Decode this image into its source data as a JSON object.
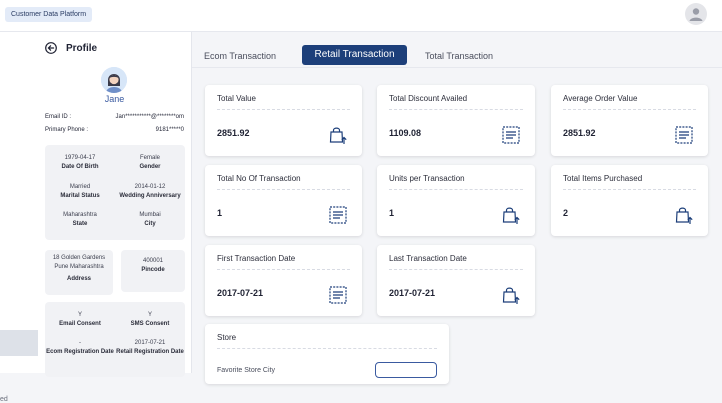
{
  "app": {
    "title": "Customer Data Platform"
  },
  "profile": {
    "title": "Profile",
    "name": "Jane",
    "email_label": "Email ID :",
    "email_value": "Jan***********@********om",
    "phone_label": "Primary Phone :",
    "phone_value": "9181*****0",
    "details": [
      {
        "value": "1979-04-17",
        "label": "Date Of Birth"
      },
      {
        "value": "Female",
        "label": "Gender"
      },
      {
        "value": "Married",
        "label": "Marital Status"
      },
      {
        "value": "2014-01-12",
        "label": "Wedding Anniversary"
      },
      {
        "value": "Maharashtra",
        "label": "State"
      },
      {
        "value": "Mumbai",
        "label": "City"
      }
    ],
    "address": {
      "line1": "18 Golden Gardens",
      "line2": "Pune Maharashtra",
      "label": "Address"
    },
    "pincode": {
      "value": "400001",
      "label": "Pincode"
    },
    "consents": [
      {
        "value": "Y",
        "label": "Email Consent"
      },
      {
        "value": "Y",
        "label": "SMS Consent"
      },
      {
        "value": "-",
        "label": "Ecom Registration Date"
      },
      {
        "value": "2017-07-21",
        "label": "Retail Registration Date"
      }
    ]
  },
  "tabs": [
    {
      "label": "Ecom Transaction",
      "active": false
    },
    {
      "label": "Retail Transaction",
      "active": true
    },
    {
      "label": "Total Transaction",
      "active": false
    }
  ],
  "metrics": [
    {
      "title": "Total Value",
      "value": "2851.92",
      "icon": "shopping-bag-icon"
    },
    {
      "title": "Total Discount Availed",
      "value": "1109.08",
      "icon": "receipt-icon"
    },
    {
      "title": "Average Order Value",
      "value": "2851.92",
      "icon": "receipt-icon"
    },
    {
      "title": "Total No Of Transaction",
      "value": "1",
      "icon": "receipt-icon"
    },
    {
      "title": "Units per Transaction",
      "value": "1",
      "icon": "shopping-bag-icon"
    },
    {
      "title": "Total Items Purchased",
      "value": "2",
      "icon": "shopping-bag-icon"
    },
    {
      "title": "First Transaction Date",
      "value": "2017-07-21",
      "icon": "receipt-icon"
    },
    {
      "title": "Last Transaction Date",
      "value": "2017-07-21",
      "icon": "shopping-bag-icon"
    }
  ],
  "store": {
    "title": "Store",
    "favorite_label": "Favorite Store City"
  },
  "nav": {
    "partial_label": "ed"
  },
  "colors": {
    "accent": "#1d3f7a",
    "link": "#3a5aa0",
    "badge_bg": "#e3ebf8"
  }
}
